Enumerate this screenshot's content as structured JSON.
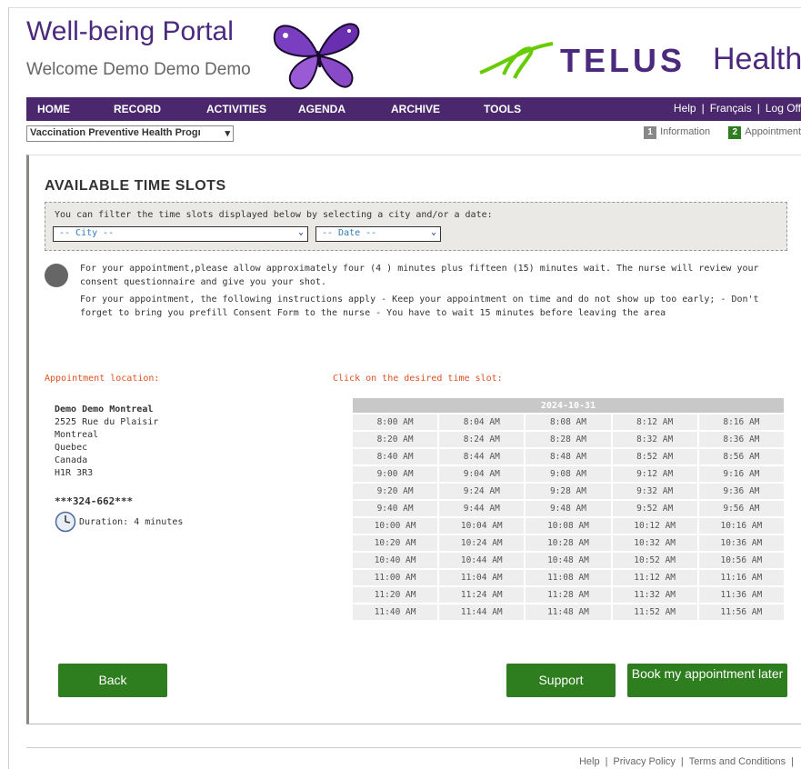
{
  "header": {
    "title": "Well-being Portal",
    "welcome": "Welcome Demo Demo Demo",
    "brand": "TELUS",
    "brand_suffix": "Health"
  },
  "nav": {
    "items": [
      "HOME",
      "RECORD",
      "ACTIVITIES",
      "AGENDA",
      "ARCHIVE",
      "TOOLS"
    ],
    "help": "Help",
    "language": "Français",
    "logoff": "Log Off"
  },
  "program": {
    "selected": "Vaccination Preventive Health Progı"
  },
  "steps": {
    "s1_num": "1",
    "s1_label": "Information",
    "s2_num": "2",
    "s2_label": "Appointment"
  },
  "main": {
    "heading": "AVAILABLE TIME SLOTS",
    "filter_text": "You can filter the time slots displayed below by selecting a city and/or a date:",
    "city_placeholder": "-- City --",
    "date_placeholder": "-- Date --",
    "info1": "For your appointment,please allow approximately four (4 ) minutes plus fifteen (15) minutes wait. The nurse will review your consent questionnaire and give you your shot.",
    "info2": "For your appointment, the following instructions apply - Keep your appointment on time and do not show up too early; - Don't forget to bring you prefill Consent Form to the nurse - You have to wait 15 minutes before leaving the area",
    "location_label": "Appointment location:",
    "slot_label": "Click on the desired time slot:"
  },
  "location": {
    "name": "Demo Demo Montreal",
    "street": "2525 Rue du Plaisir",
    "city": "Montreal",
    "province": "Quebec",
    "country": "Canada",
    "postal": "H1R 3R3",
    "phone": "***324-662***",
    "duration": "Duration: 4 minutes"
  },
  "slots": {
    "date": "2024-10-31",
    "rows": [
      [
        "8:00 AM",
        "8:04 AM",
        "8:08 AM",
        "8:12 AM",
        "8:16 AM"
      ],
      [
        "8:20 AM",
        "8:24 AM",
        "8:28 AM",
        "8:32 AM",
        "8:36 AM"
      ],
      [
        "8:40 AM",
        "8:44 AM",
        "8:48 AM",
        "8:52 AM",
        "8:56 AM"
      ],
      [
        "9:00 AM",
        "9:04 AM",
        "9:08 AM",
        "9:12 AM",
        "9:16 AM"
      ],
      [
        "9:20 AM",
        "9:24 AM",
        "9:28 AM",
        "9:32 AM",
        "9:36 AM"
      ],
      [
        "9:40 AM",
        "9:44 AM",
        "9:48 AM",
        "9:52 AM",
        "9:56 AM"
      ],
      [
        "10:00 AM",
        "10:04 AM",
        "10:08 AM",
        "10:12 AM",
        "10:16 AM"
      ],
      [
        "10:20 AM",
        "10:24 AM",
        "10:28 AM",
        "10:32 AM",
        "10:36 AM"
      ],
      [
        "10:40 AM",
        "10:44 AM",
        "10:48 AM",
        "10:52 AM",
        "10:56 AM"
      ],
      [
        "11:00 AM",
        "11:04 AM",
        "11:08 AM",
        "11:12 AM",
        "11:16 AM"
      ],
      [
        "11:20 AM",
        "11:24 AM",
        "11:28 AM",
        "11:32 AM",
        "11:36 AM"
      ],
      [
        "11:40 AM",
        "11:44 AM",
        "11:48 AM",
        "11:52 AM",
        "11:56 AM"
      ]
    ]
  },
  "buttons": {
    "back": "Back",
    "support": "Support",
    "later": "Book my appointment later"
  },
  "footer": {
    "help": "Help",
    "privacy": "Privacy Policy",
    "terms": "Terms and Conditions",
    "sep": "|"
  },
  "colors": {
    "brand_purple": "#4b286d",
    "button_green": "#2e7d1e",
    "label_red": "#e05020"
  }
}
